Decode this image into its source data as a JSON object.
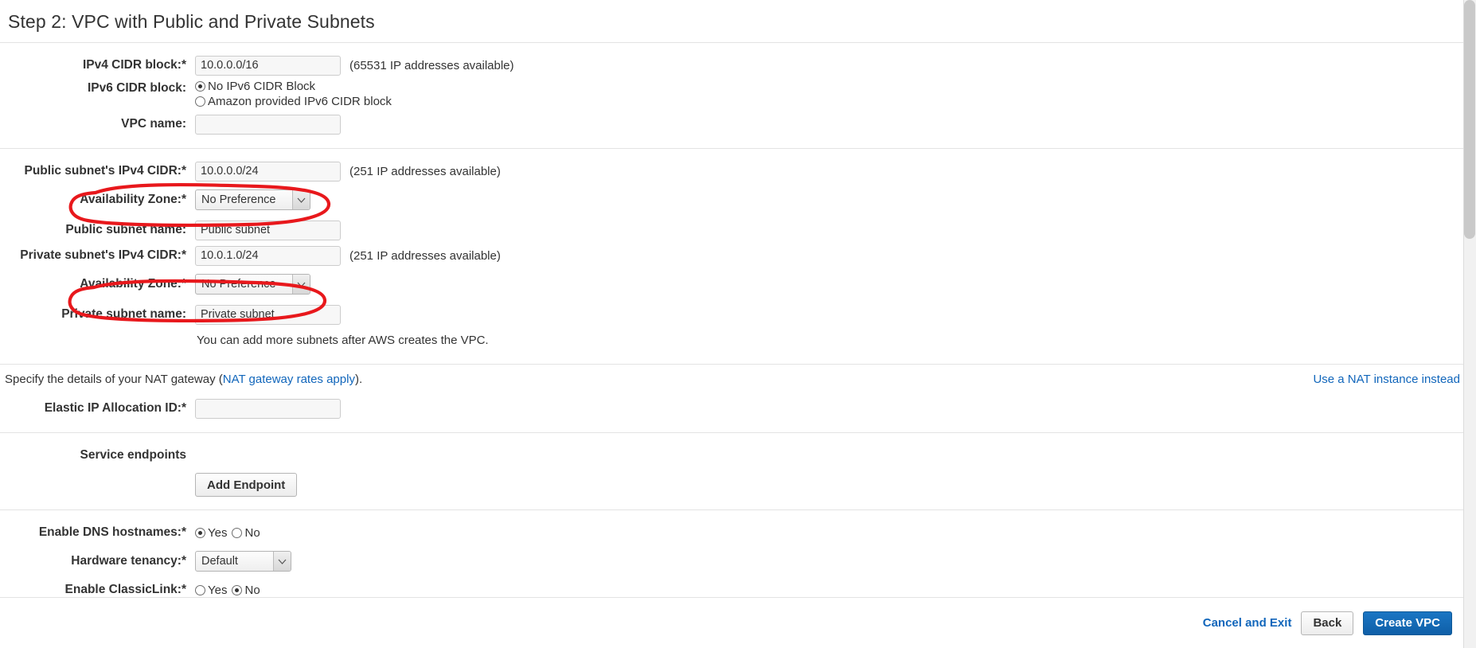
{
  "header": {
    "title": "Step 2: VPC with Public and Private Subnets"
  },
  "vpc_section": {
    "ipv4_cidr": {
      "label": "IPv4 CIDR block:*",
      "value": "10.0.0.0/16",
      "hint": "(65531 IP addresses available)"
    },
    "ipv6_cidr": {
      "label": "IPv6 CIDR block:",
      "options": [
        {
          "label": "No IPv6 CIDR Block",
          "selected": true
        },
        {
          "label": "Amazon provided IPv6 CIDR block",
          "selected": false
        }
      ]
    },
    "vpc_name": {
      "label": "VPC name:",
      "value": "",
      "placeholder": ""
    }
  },
  "subnets_section": {
    "public_cidr": {
      "label": "Public subnet's IPv4 CIDR:*",
      "value": "10.0.0.0/24",
      "hint": "(251 IP addresses available)"
    },
    "public_az": {
      "label": "Availability Zone:*",
      "value": "No Preference"
    },
    "public_name": {
      "label": "Public subnet name:",
      "value": "Public subnet"
    },
    "private_cidr": {
      "label": "Private subnet's IPv4 CIDR:*",
      "value": "10.0.1.0/24",
      "hint": "(251 IP addresses available)"
    },
    "private_az": {
      "label": "Availability Zone:*",
      "value": "No Preference"
    },
    "private_name": {
      "label": "Private subnet name:",
      "value": "Private subnet"
    },
    "note": "You can add more subnets after AWS creates the VPC."
  },
  "nat_section": {
    "text_before": "Specify the details of your NAT gateway (",
    "link": "NAT gateway rates apply",
    "text_after": ").",
    "alt_link": "Use a NAT instance instead",
    "eip": {
      "label": "Elastic IP Allocation ID:*",
      "value": "",
      "placeholder": ""
    }
  },
  "endpoints_section": {
    "label": "Service endpoints",
    "add_button": "Add Endpoint"
  },
  "options_section": {
    "dns_hostnames": {
      "label": "Enable DNS hostnames:*",
      "options": [
        {
          "label": "Yes",
          "selected": true
        },
        {
          "label": "No",
          "selected": false
        }
      ]
    },
    "tenancy": {
      "label": "Hardware tenancy:*",
      "value": "Default"
    },
    "classiclink": {
      "label": "Enable ClassicLink:*",
      "options": [
        {
          "label": "Yes",
          "selected": false
        },
        {
          "label": "No",
          "selected": true
        }
      ]
    }
  },
  "footer": {
    "cancel": "Cancel and Exit",
    "back": "Back",
    "create": "Create VPC"
  },
  "colors": {
    "primary_blue": "#1166bb",
    "link_blue": "#1166bb",
    "annotation_red": "#e8181c",
    "text": "#333333",
    "divider": "#e3e3e3"
  },
  "annotations": [
    {
      "name": "highlight-public-az",
      "shape": "ellipse"
    },
    {
      "name": "highlight-private-az",
      "shape": "ellipse"
    }
  ]
}
